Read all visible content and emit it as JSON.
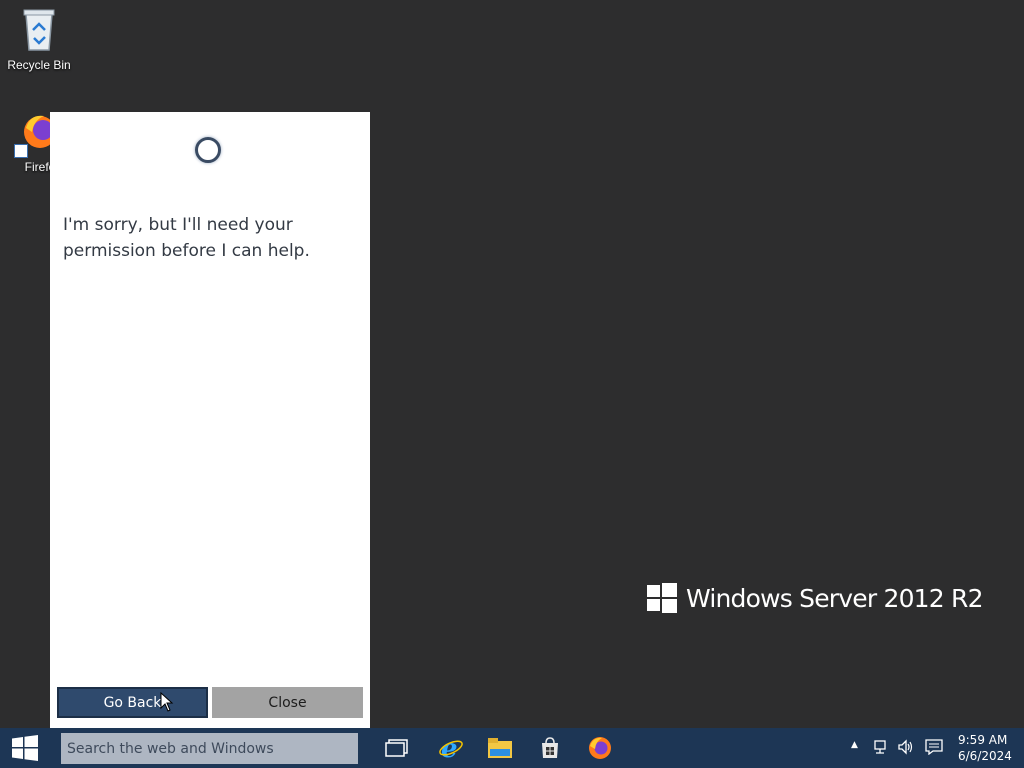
{
  "desktop": {
    "icons": [
      {
        "label": "Recycle Bin",
        "icon": "recycle-bin-icon"
      },
      {
        "label": "Firefo",
        "icon": "firefox-icon"
      }
    ],
    "watermark": "Windows Server 2012 R2"
  },
  "cortana": {
    "message": "I'm sorry, but I'll need your permission before I can help.",
    "go_back_label": "Go Back",
    "close_label": "Close"
  },
  "taskbar": {
    "search_placeholder": "Search the web and Windows",
    "pinned": [
      "task-view-icon",
      "internet-explorer-icon",
      "file-explorer-icon",
      "store-icon",
      "firefox-icon"
    ],
    "tray_expand": "▲",
    "clock_time": "9:59 AM",
    "clock_date": "6/6/2024"
  },
  "colors": {
    "desktop_bg": "#2d2d2e",
    "taskbar_bg": "#1d3655",
    "accent_button": "#2f4a6d"
  }
}
